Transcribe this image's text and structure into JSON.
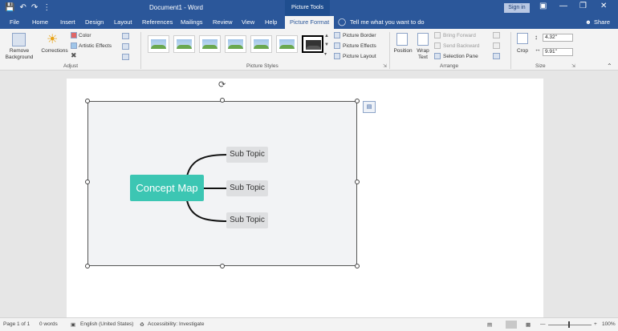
{
  "title_bar": {
    "document_title": "Document1 - Word",
    "context_label": "Picture Tools",
    "signin_label": "Sign in",
    "save_icon": "save-icon",
    "undo_icon": "undo-icon",
    "redo_icon": "redo-icon",
    "accent": "#2b579a"
  },
  "tabs": {
    "file": "File",
    "home": "Home",
    "insert": "Insert",
    "design": "Design",
    "layout": "Layout",
    "references": "References",
    "mailings": "Mailings",
    "review": "Review",
    "view": "View",
    "help": "Help",
    "picture_format": "Picture Format",
    "tell_me": "Tell me what you want to do",
    "share": "Share"
  },
  "ribbon": {
    "remove_background": "Remove Background",
    "corrections": "Corrections",
    "color": "Color",
    "artistic_effects": "Artistic Effects",
    "adjust_label": "Adjust",
    "picture_styles_label": "Picture Styles",
    "picture_border": "Picture Border",
    "picture_effects": "Picture Effects",
    "picture_layout": "Picture Layout",
    "position": "Position",
    "wrap_text": "Wrap Text",
    "bring_forward": "Bring Forward",
    "send_backward": "Send Backward",
    "selection_pane": "Selection Pane",
    "arrange_label": "Arrange",
    "crop": "Crop",
    "height_value": "4.32\"",
    "width_value": "9.91\"",
    "size_label": "Size"
  },
  "diagram": {
    "concept": "Concept Map",
    "subtopics": [
      "Sub Topic",
      "Sub Topic",
      "Sub Topic"
    ],
    "concept_color": "#3cc6b3"
  },
  "status_bar": {
    "page": "Page 1 of 1",
    "words": "0 words",
    "language": "English (United States)",
    "accessibility": "Accessibility: Investigate",
    "zoom": "100%"
  }
}
